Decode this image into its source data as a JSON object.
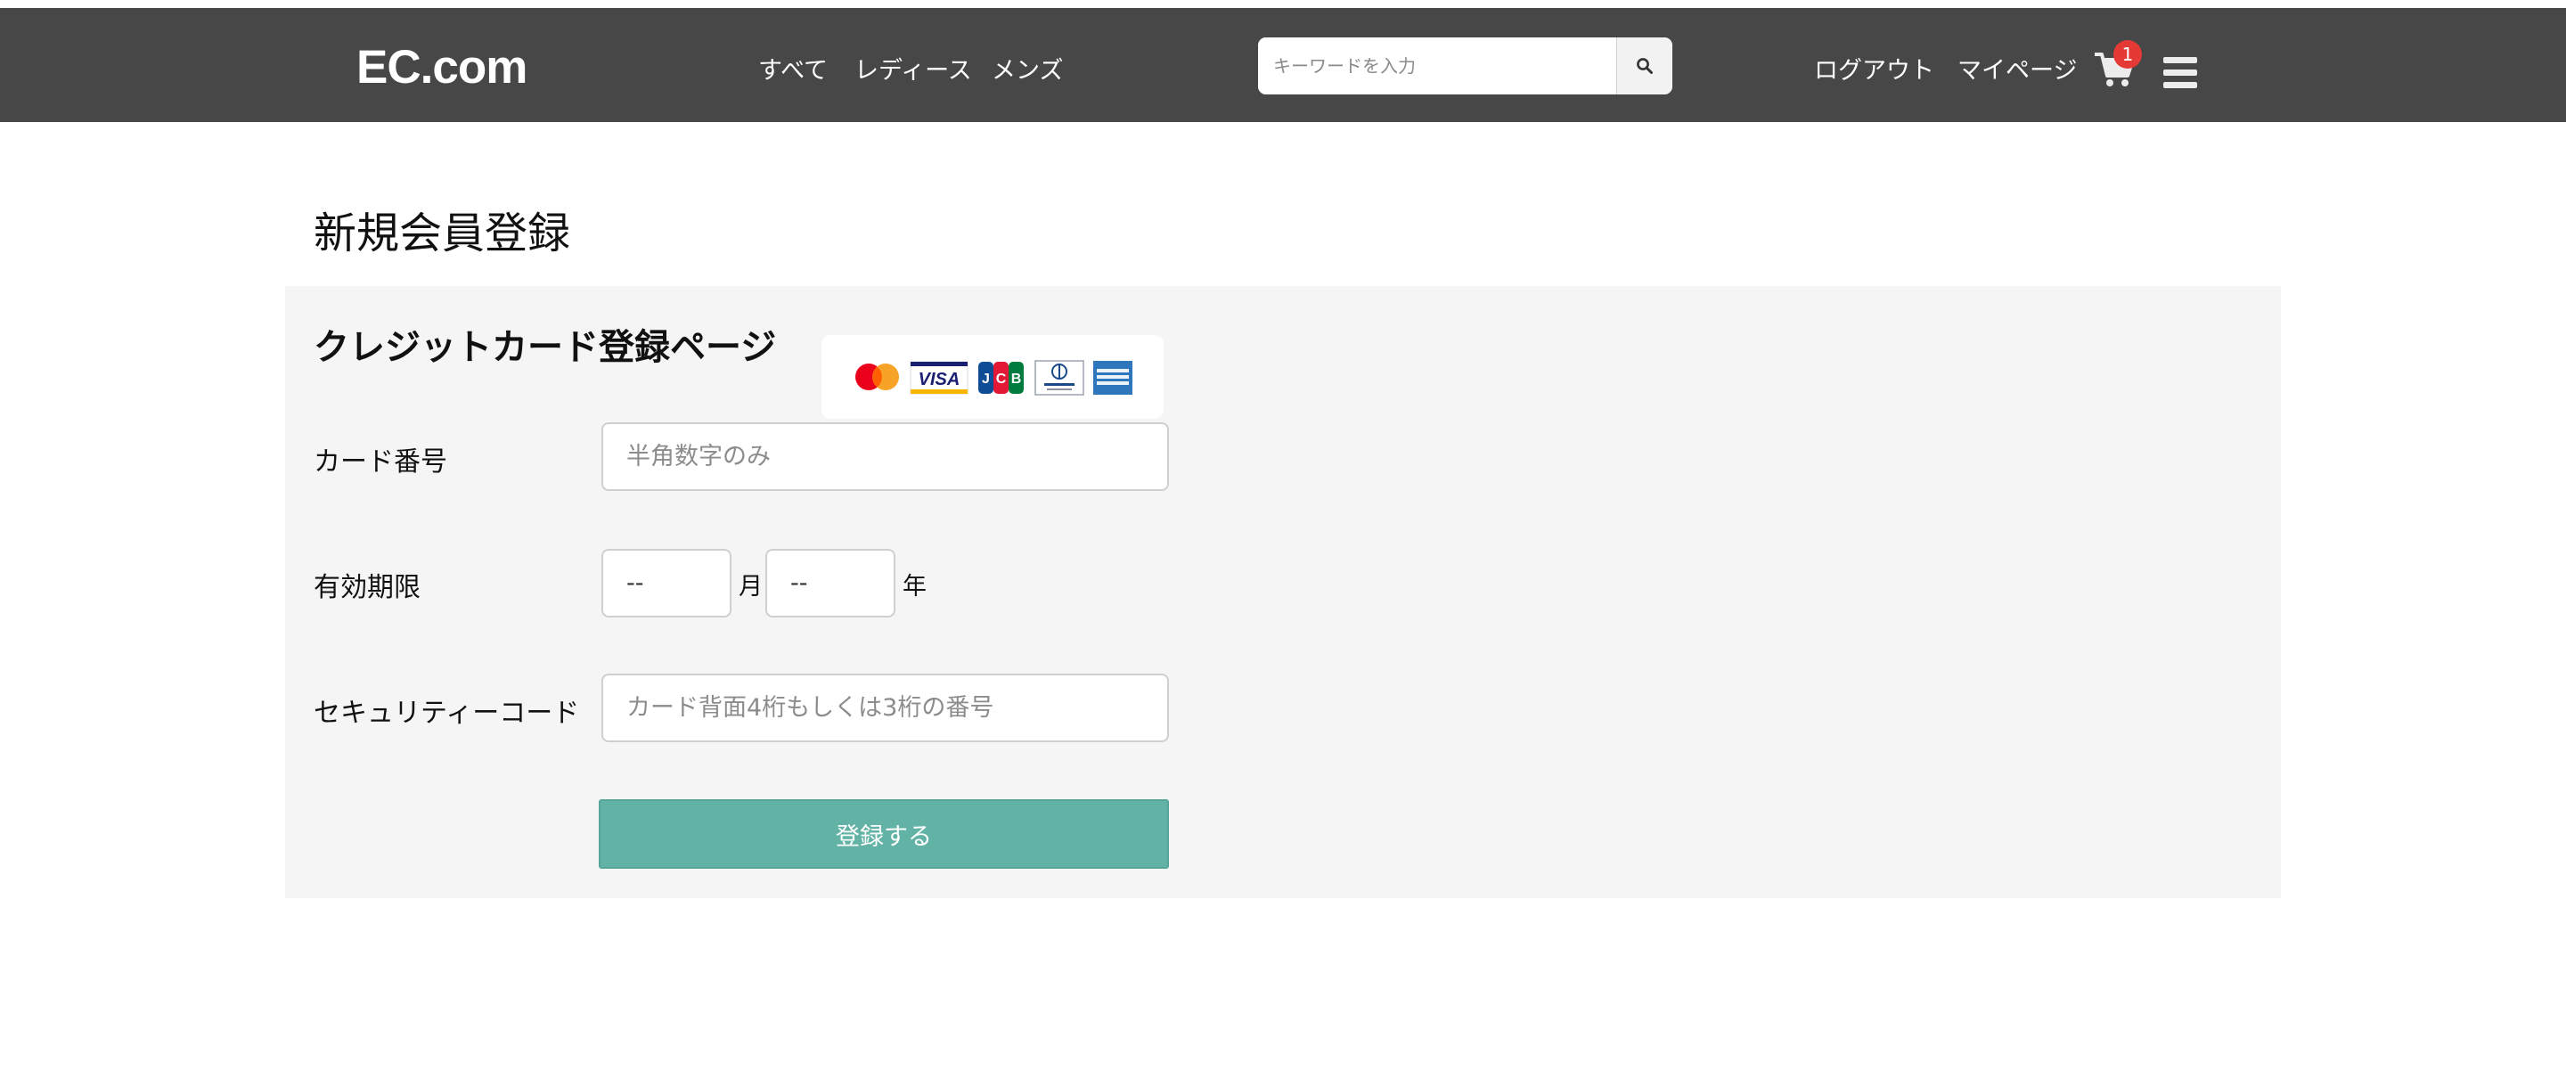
{
  "header": {
    "logo": "EC.com",
    "nav": [
      {
        "label": "すべて"
      },
      {
        "label": "レディース"
      },
      {
        "label": "メンズ"
      }
    ],
    "search": {
      "placeholder": "キーワードを入力",
      "value": ""
    },
    "logout_label": "ログアウト",
    "mypage_label": "マイページ",
    "cart_count": "1",
    "icons": {
      "search": "search-icon",
      "cart": "cart-icon",
      "menu": "hamburger-menu-icon"
    }
  },
  "page": {
    "title": "新規会員登録"
  },
  "form": {
    "title": "クレジットカード登録ページ",
    "card_brands": [
      "mastercard-logo",
      "visa-logo",
      "jcb-logo",
      "diners-club-logo",
      "american-express-logo"
    ],
    "card_number": {
      "label": "カード番号",
      "placeholder": "半角数字のみ",
      "value": ""
    },
    "expiry": {
      "label": "有効期限",
      "month": {
        "value": "--",
        "unit": "月"
      },
      "year": {
        "value": "--",
        "unit": "年"
      }
    },
    "security_code": {
      "label": "セキュリティーコード",
      "placeholder": "カード背面4桁もしくは3桁の番号",
      "value": ""
    },
    "submit_label": "登録する"
  },
  "colors": {
    "navbar": "#474747",
    "panel": "#f5f5f5",
    "submit": "#62b3a6",
    "badge": "#e53935"
  }
}
